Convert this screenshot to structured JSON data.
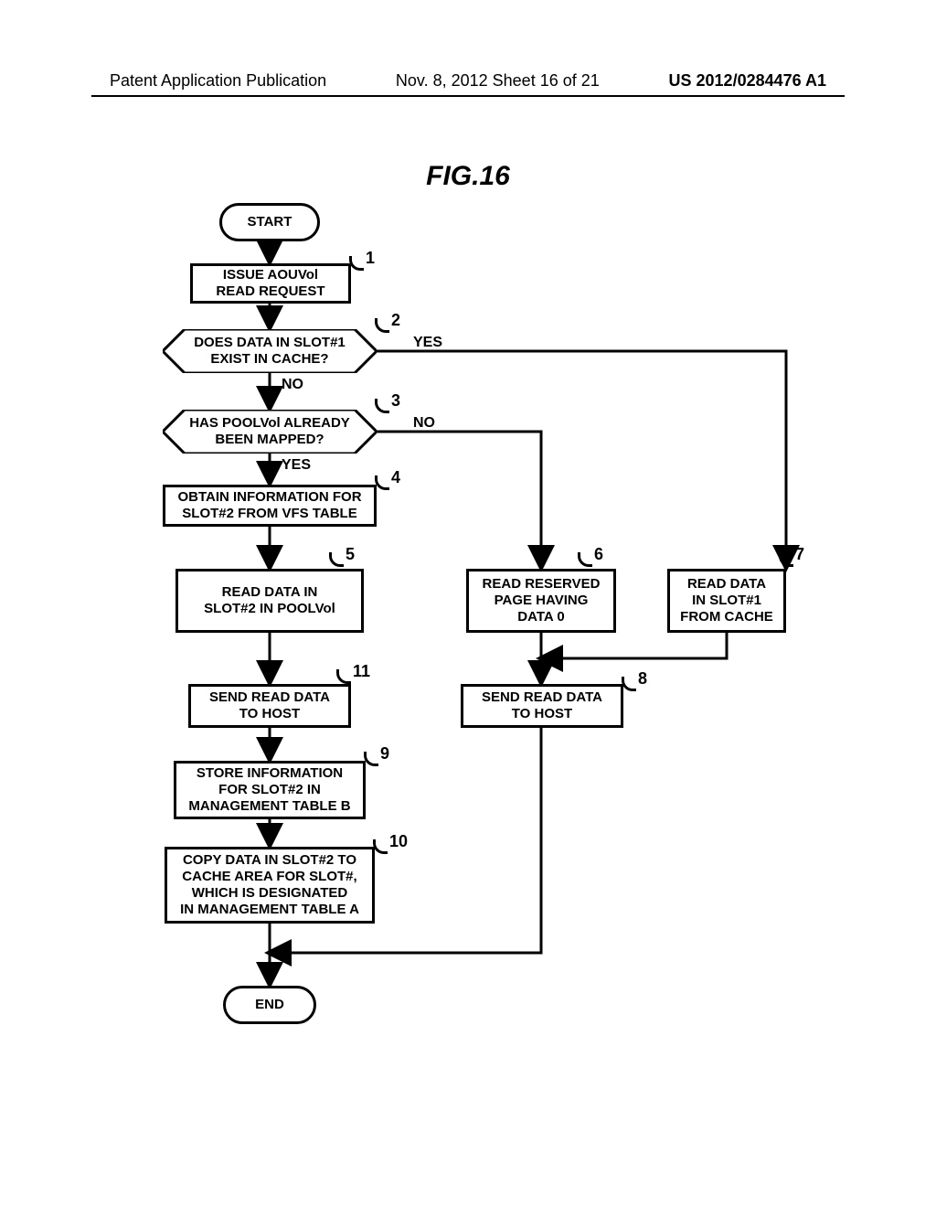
{
  "header": {
    "left": "Patent Application Publication",
    "mid": "Nov. 8, 2012  Sheet 16 of 21",
    "right": "US 2012/0284476 A1"
  },
  "figure_title": "FIG.16",
  "nodes": {
    "start": "START",
    "n1": "ISSUE AOUVol\nREAD REQUEST",
    "n2": "DOES DATA IN SLOT#1\nEXIST IN CACHE?",
    "n3": "HAS POOLVol ALREADY\nBEEN MAPPED?",
    "n4": "OBTAIN INFORMATION FOR\nSLOT#2 FROM VFS TABLE",
    "n5": "READ DATA IN\nSLOT#2 IN POOLVol",
    "n6": "READ RESERVED\nPAGE HAVING\nDATA 0",
    "n7": "READ DATA\nIN SLOT#1\nFROM CACHE",
    "n8": "SEND READ DATA\nTO HOST",
    "n11": "SEND READ DATA\nTO HOST",
    "n9": "STORE INFORMATION\nFOR SLOT#2 IN\nMANAGEMENT TABLE B",
    "n10": "COPY DATA IN SLOT#2 TO\nCACHE AREA FOR SLOT#,\nWHICH IS DESIGNATED\nIN MANAGEMENT TABLE A",
    "end": "END"
  },
  "labels": {
    "yes2": "YES",
    "no2": "NO",
    "no3": "NO",
    "yes3": "YES"
  },
  "nums": {
    "n1": "1",
    "n2": "2",
    "n3": "3",
    "n4": "4",
    "n5": "5",
    "n6": "6",
    "n7": "7",
    "n8": "8",
    "n9": "9",
    "n10": "10",
    "n11": "11"
  }
}
